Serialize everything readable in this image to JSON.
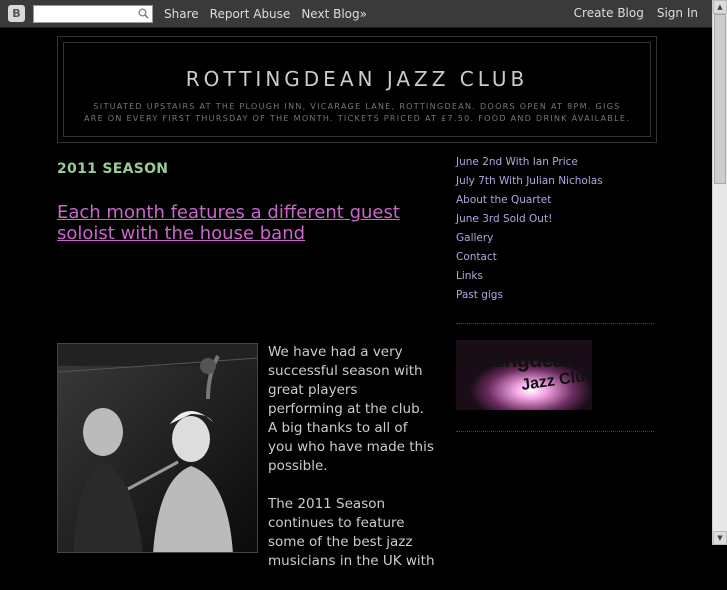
{
  "navbar": {
    "logo_glyph": "B",
    "search_value": "",
    "links": [
      "Share",
      "Report Abuse",
      "Next Blog»"
    ],
    "right_links": [
      "Create Blog",
      "Sign In"
    ]
  },
  "header": {
    "title": "ROTTINGDEAN JAZZ CLUB",
    "description": "Situated upstairs at The Plough Inn, Vicarage Lane, Rottingdean. Doors open at 8pm. Gigs are on every first Thursday of the month. Tickets priced at £7.50. Food and drink available."
  },
  "post": {
    "date_header": "2011 SEASON",
    "title": "Each month features a different guest soloist with the house band",
    "paragraphs": [
      "We have had a very successful season with great players performing at the club. A big thanks to all of you who have made this possible.",
      "The 2011 Season continues to feature some of the best jazz musicians in the UK with"
    ]
  },
  "sidebar": {
    "links": [
      "June 2nd With Ian Price",
      "July 7th With Julian Nicholas",
      "About the Quartet",
      "June 3rd Sold Out!",
      "Gallery",
      "Contact",
      "Links",
      "Past gigs"
    ],
    "logo_line1": "Rottingdean",
    "logo_line2": "Jazz Club"
  },
  "colors": {
    "background": "#000000",
    "title": "#cccccc",
    "date_header": "#99cc99",
    "post_title": "#cc66cc",
    "sidebar_link": "#aaaadd"
  }
}
